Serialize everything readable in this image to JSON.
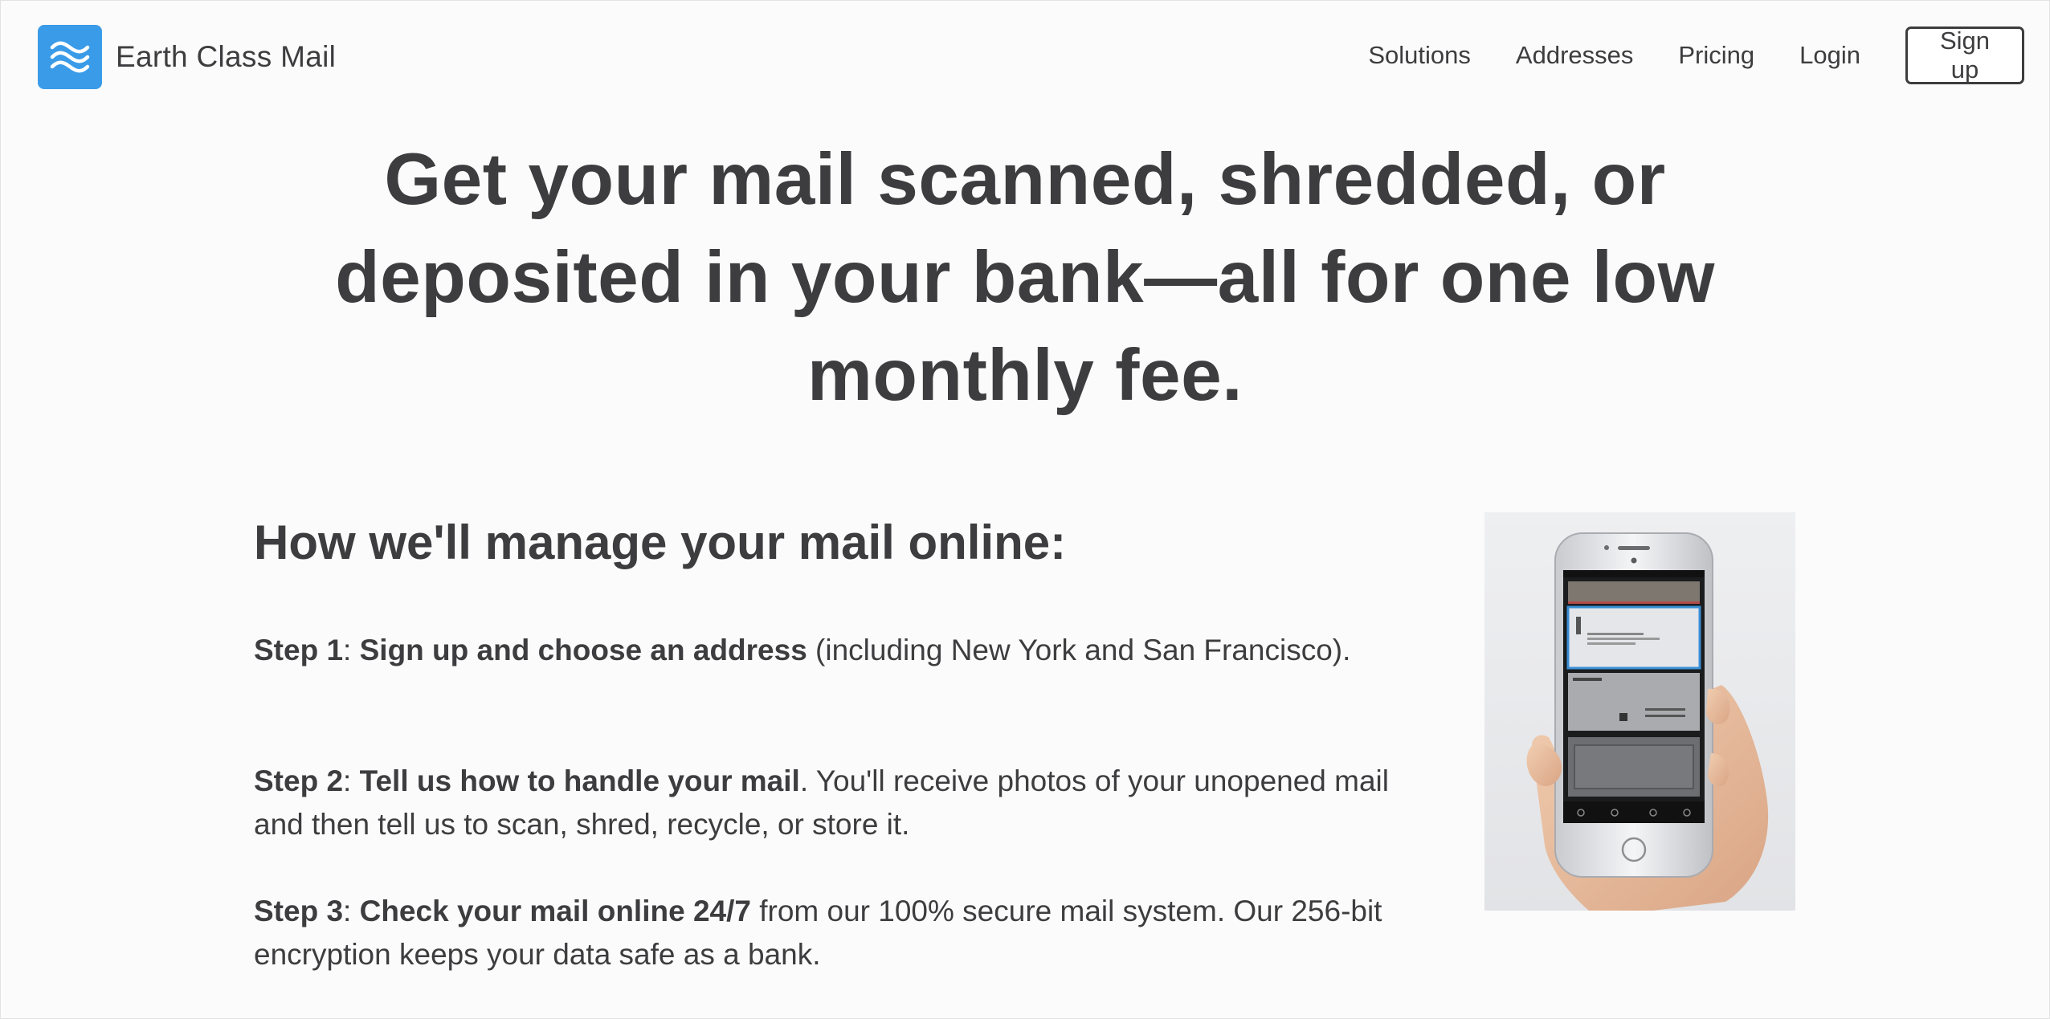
{
  "brand": {
    "name": "Earth Class Mail",
    "color": "#3a9be8"
  },
  "nav": {
    "links": [
      "Solutions",
      "Addresses",
      "Pricing",
      "Login"
    ],
    "signup_label": "Sign up"
  },
  "hero": {
    "title": "Get your mail scanned, shredded, or deposited in your bank—all for one low monthly fee."
  },
  "how": {
    "heading": "How we'll manage your mail online:",
    "steps": [
      {
        "label": "Step 1",
        "bold": "Sign up and choose an address",
        "text": " (including New York and San Francisco)."
      },
      {
        "label": "Step 2",
        "bold": "Tell us how to handle your mail",
        "text": ". You'll receive photos of your unopened mail and then tell us to scan, shred, recycle, or store it."
      },
      {
        "label": "Step 3",
        "bold": "Check your mail online 24/7",
        "text": " from our 100% secure mail system. Our 256-bit encryption keeps your data safe as a bank."
      }
    ]
  },
  "illustration": {
    "icon": "phone-in-hand-illustration"
  }
}
